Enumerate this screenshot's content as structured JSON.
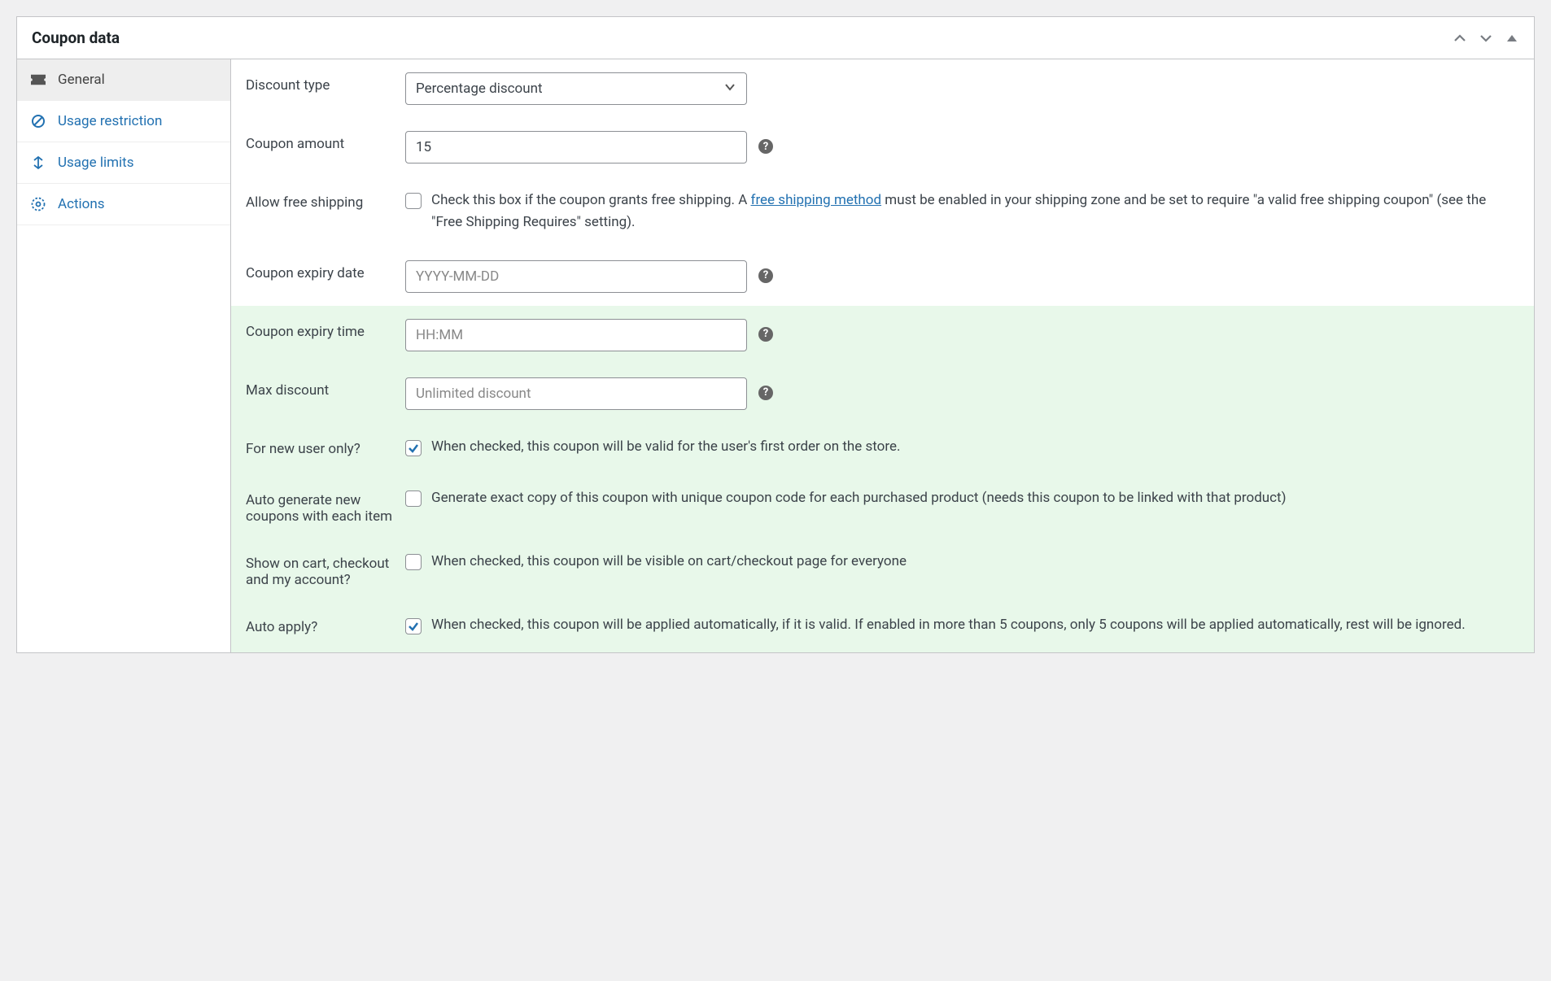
{
  "panel": {
    "title": "Coupon data"
  },
  "sidebar": {
    "items": [
      {
        "label": "General"
      },
      {
        "label": "Usage restriction"
      },
      {
        "label": "Usage limits"
      },
      {
        "label": "Actions"
      }
    ]
  },
  "fields": {
    "discount_type": {
      "label": "Discount type",
      "value": "Percentage discount"
    },
    "coupon_amount": {
      "label": "Coupon amount",
      "value": "15"
    },
    "allow_free_shipping": {
      "label": "Allow free shipping",
      "desc_pre": "Check this box if the coupon grants free shipping. A ",
      "link_text": "free shipping method",
      "desc_post": " must be enabled in your shipping zone and be set to require \"a valid free shipping coupon\" (see the \"Free Shipping Requires\" setting)."
    },
    "coupon_expiry_date": {
      "label": "Coupon expiry date",
      "placeholder": "YYYY-MM-DD"
    },
    "coupon_expiry_time": {
      "label": "Coupon expiry time",
      "placeholder": "HH:MM"
    },
    "max_discount": {
      "label": "Max discount",
      "placeholder": "Unlimited discount"
    },
    "for_new_user": {
      "label": "For new user only?",
      "desc": "When checked, this coupon will be valid for the user's first order on the store."
    },
    "auto_generate": {
      "label": "Auto generate new coupons with each item",
      "desc": "Generate exact copy of this coupon with unique coupon code for each purchased product (needs this coupon to be linked with that product)"
    },
    "show_on_cart": {
      "label": "Show on cart, checkout and my account?",
      "desc": "When checked, this coupon will be visible on cart/checkout page for everyone"
    },
    "auto_apply": {
      "label": "Auto apply?",
      "desc": "When checked, this coupon will be applied automatically, if it is valid. If enabled in more than 5 coupons, only 5 coupons will be applied automatically, rest will be ignored."
    }
  }
}
